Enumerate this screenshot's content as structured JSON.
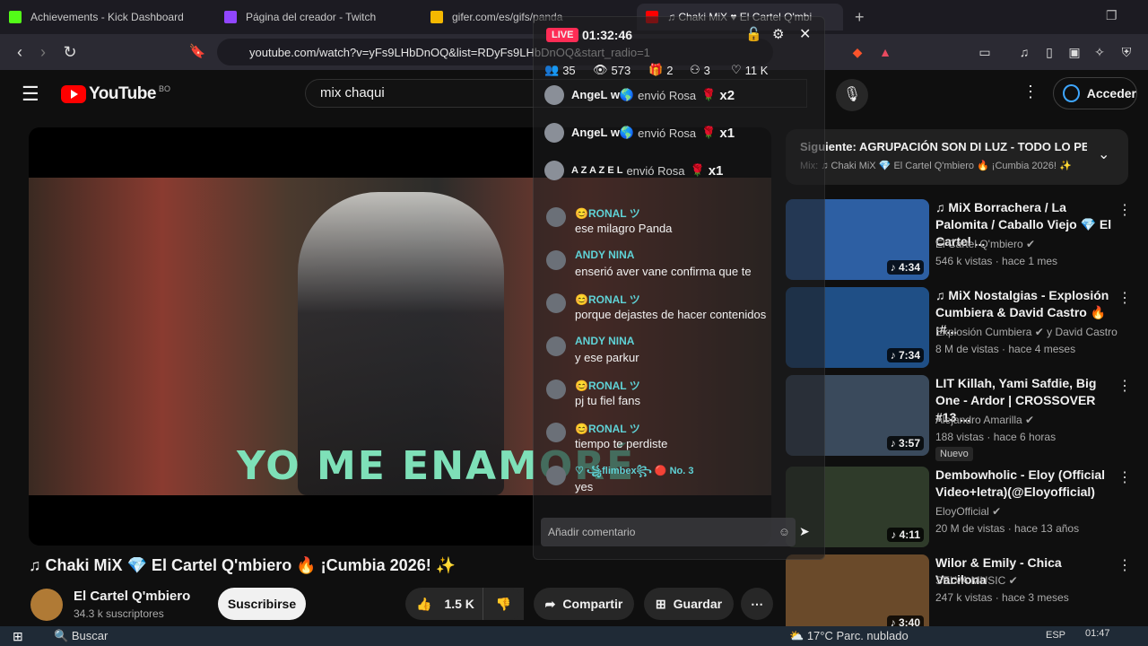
{
  "browser": {
    "tabs": [
      {
        "label": "Achievements - Kick Dashboard",
        "color": "#53fc18"
      },
      {
        "label": "Página del creador - Twitch",
        "color": "#9146ff"
      },
      {
        "label": "gifer.com/es/gifs/panda",
        "color": "#f5b800"
      },
      {
        "label": "♫ Chaki MiX ♥ El Cartel Q'mbi",
        "color": "#ff0000"
      }
    ],
    "url": "youtube.com/watch?v=yFs9LHbDnOQ&list=RDyFs9LHbDnOQ&start_radio=1"
  },
  "youtube": {
    "logo_text": "YouTube",
    "country": "BO",
    "search_value": "mix chaqui",
    "signin_label": "Acceder",
    "video_caption": "YO ME ENAMORÉ",
    "video_title": "♫ Chaki MiX 💎 El Cartel Q'mbiero 🔥 ¡Cumbia 2026! ✨",
    "channel_name": "El Cartel Q'mbiero",
    "subscribers": "34.3 k suscriptores",
    "subscribe_label": "Suscribirse",
    "like_count": "1.5 K",
    "share_label": "Compartir",
    "save_label": "Guardar",
    "up_next": {
      "title": "Siguiente: AGRUPACIÓN SON DI LUZ - TODO LO PE...",
      "subtitle": "Mix: ♫ Chaki MiX 💎 El Cartel Q'mbiero 🔥 ¡Cumbia 2026! ✨"
    },
    "recommendations": [
      {
        "title": "♫ MiX Borrachera / La Palomita / Caballo Viejo 💎 El Cartel ...",
        "channel": "El Cartel Q'mbiero ✔",
        "meta": "546 k vistas · hace 1 mes",
        "duration": "♪ 4:34",
        "color": "#2d5fa3"
      },
      {
        "title": "♫ MiX Nostalgias - Explosión Cumbiera & David Castro 🔥 ¡#...",
        "channel": "Explosión Cumbiera ✔ y David Castro",
        "meta": "8 M de vistas · hace 4 meses",
        "duration": "♪ 7:34",
        "color": "#1f4f86"
      },
      {
        "title": "LIT Killah, Yami Safdie, Big One - Ardor | CROSSOVER #13 ...",
        "channel": "Alejandro Amarilla ✔",
        "meta": "188 vistas · hace 6 horas",
        "duration": "♪ 3:57",
        "badge": "Nuevo",
        "color": "#3a4a5c"
      },
      {
        "title": "Dembowholic - Eloy (Official Video+letra)(@Eloyofficial)",
        "channel": "EloyOfficial ✔",
        "meta": "20 M de vistas · hace 13 años",
        "duration": "♪ 4:11",
        "color": "#2f3b2a"
      },
      {
        "title": "Wilor & Emily - Chica Vacilona",
        "channel": "SELVA MUSIC ✔",
        "meta": "247 k vistas · hace 3 meses",
        "duration": "♪ 3:40",
        "color": "#6a4a2a"
      }
    ]
  },
  "live_overlay": {
    "live_label": "LIVE",
    "timer": "01:32:46",
    "stats": {
      "viewers": "35",
      "views": "573",
      "gifts": "2",
      "shares": "3",
      "likes": "11 K"
    },
    "gifts": [
      {
        "user": "AngeL w🌎",
        "action": "envió Rosa",
        "count": "x2"
      },
      {
        "user": "AngeL w🌎",
        "action": "envió Rosa",
        "count": "x1"
      },
      {
        "user": "A Z A Z E L",
        "action": "envió Rosa",
        "count": "x1"
      }
    ],
    "messages": [
      {
        "user": "😊RONAL ツ",
        "text": "ese milagro Panda"
      },
      {
        "user": "ANDY NINA",
        "text": "enserió aver vane confirma que te"
      },
      {
        "user": "😊RONAL ツ",
        "text": "porque dejastes de hacer contenidos"
      },
      {
        "user": "ANDY NINA",
        "text": "y ese parkur"
      },
      {
        "user": "😊RONAL ツ",
        "text": "pj tu fiel fans"
      },
      {
        "user": "😊RONAL ツ",
        "text": "tiempo te perdiste"
      },
      {
        "user": "♡ ꧁flimbex꧂ 🔴 No. 3",
        "text": "yes"
      }
    ],
    "comment_placeholder": "Añadir comentario"
  },
  "taskbar": {
    "search_label": "Buscar",
    "weather": "17°C  Parc. nublado",
    "lang": "ESP",
    "time": "01:47"
  }
}
